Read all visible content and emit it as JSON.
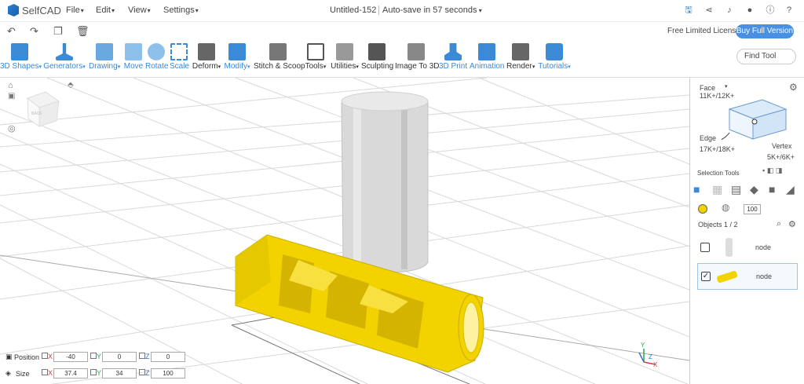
{
  "app": {
    "name": "SelfCAD"
  },
  "menu": [
    "File",
    "Edit",
    "View",
    "Settings"
  ],
  "document": {
    "title": "Untitled-152",
    "autosave": "Auto-save in 57 seconds"
  },
  "account": {
    "license": "Free Limited License",
    "buy_label": "Buy Full Version"
  },
  "toolbar": {
    "items": [
      {
        "label": "3D Shapes",
        "color": "#3a8ad6"
      },
      {
        "label": "Generators",
        "color": "#3a8ad6"
      },
      {
        "label": "Drawing",
        "color": "#3a8ad6"
      },
      {
        "label": "Move",
        "color": "#3a8ad6"
      },
      {
        "label": "Rotate",
        "color": "#3a8ad6"
      },
      {
        "label": "Scale",
        "color": "#3a8ad6"
      },
      {
        "label": "Deform",
        "color": "#333333"
      },
      {
        "label": "Modify",
        "color": "#3a8ad6"
      },
      {
        "label": "Stitch & Scoop",
        "color": "#333333"
      },
      {
        "label": "Tools",
        "color": "#333333"
      },
      {
        "label": "Utilities",
        "color": "#333333"
      },
      {
        "label": "Sculpting",
        "color": "#333333"
      },
      {
        "label": "Image To 3D",
        "color": "#333333"
      },
      {
        "label": "3D Print",
        "color": "#3a8ad6"
      },
      {
        "label": "Animation",
        "color": "#3a8ad6"
      },
      {
        "label": "Render",
        "color": "#333333"
      },
      {
        "label": "Tutorials",
        "color": "#3a8ad6"
      }
    ],
    "find_placeholder": "Find Tool"
  },
  "panel": {
    "face_label": "Face",
    "face_count": "11K+/12K+",
    "edge_label": "Edge",
    "edge_count": "17K+/18K+",
    "vertex_label": "Vertex",
    "vertex_count": "5K+/6K+",
    "selection_tools": "Selection Tools",
    "brush_size": "100",
    "objects_header": "Objects 1 / 2",
    "objects": [
      {
        "name": "node",
        "checked": false
      },
      {
        "name": "node",
        "checked": true
      }
    ]
  },
  "transform": {
    "position_label": "Position",
    "size_label": "Size",
    "position": {
      "x": "-40",
      "y": "0",
      "z": "0"
    },
    "size": {
      "x": "37.4",
      "y": "34",
      "z": "100"
    },
    "axes": [
      "X",
      "Y",
      "Z"
    ]
  },
  "colors": {
    "accent": "#4a90e2",
    "object_yellow": "#f2d300",
    "object_gray": "#d9d9d9"
  }
}
